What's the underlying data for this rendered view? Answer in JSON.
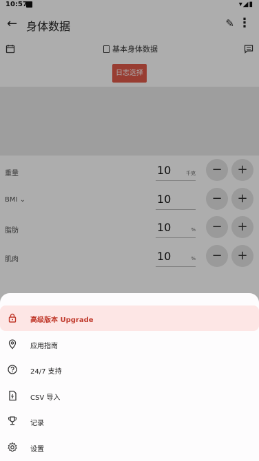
{
  "status_bar": {
    "time": "10:57",
    "system_icons": "▾◢▮"
  },
  "app_bar": {
    "title": "身体数据"
  },
  "toolbar": {
    "section_title": "基本身体数据",
    "date_button": "日志选择"
  },
  "measurements": [
    {
      "label": "重量",
      "value": "10",
      "unit": "千克",
      "minus": "−",
      "plus": "+"
    },
    {
      "label": "BMI",
      "value": "10",
      "unit": "",
      "minus": "−",
      "plus": "+"
    },
    {
      "label": "脂肪",
      "value": "10",
      "unit": "%",
      "minus": "−",
      "plus": "+"
    },
    {
      "label": "肌肉",
      "value": "10",
      "unit": "%",
      "minus": "−",
      "plus": "+"
    }
  ],
  "bmi_info_glyph": "⌄",
  "menu": [
    {
      "label": "高级版本 Upgrade",
      "icon": "lock-icon"
    },
    {
      "label": "应用指南",
      "icon": "map-pin-icon"
    },
    {
      "label": "24/7 支持",
      "icon": "help-icon"
    },
    {
      "label": "CSV 导入",
      "icon": "file-import-icon"
    },
    {
      "label": "记录",
      "icon": "trophy-icon"
    },
    {
      "label": "设置",
      "icon": "settings-icon"
    }
  ],
  "colors": {
    "accent": "#e05a4a",
    "premium_bg": "#fde6e5",
    "premium_text": "#c0392b"
  }
}
